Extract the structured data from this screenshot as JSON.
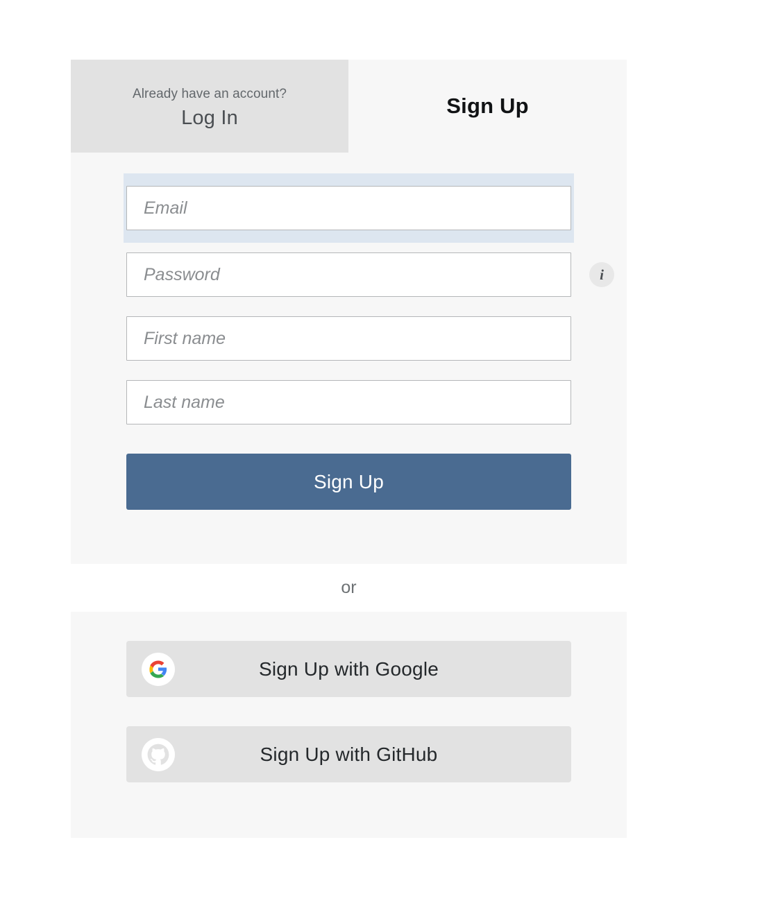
{
  "auth": {
    "tabs": {
      "login": {
        "prompt": "Already have an account?",
        "label": "Log In"
      },
      "signup": {
        "label": "Sign Up",
        "active": true
      }
    },
    "form": {
      "fields": [
        {
          "name": "email",
          "placeholder": "Email",
          "value": "",
          "type": "email",
          "focused": true
        },
        {
          "name": "password",
          "placeholder": "Password",
          "value": "",
          "type": "password",
          "focused": false,
          "info_icon": "i"
        },
        {
          "name": "first_name",
          "placeholder": "First name",
          "value": "",
          "type": "text",
          "focused": false
        },
        {
          "name": "last_name",
          "placeholder": "Last name",
          "value": "",
          "type": "text",
          "focused": false
        }
      ],
      "submit_label": "Sign Up"
    },
    "divider_label": "or",
    "social": [
      {
        "provider": "google",
        "label": "Sign Up with Google",
        "icon": "google-logo-icon"
      },
      {
        "provider": "github",
        "label": "Sign Up with GitHub",
        "icon": "github-logo-icon"
      }
    ]
  },
  "colors": {
    "primary_button": "#4a6b91",
    "active_tab_bg": "#f7f7f7",
    "inactive_tab_bg": "#e2e2e2",
    "panel_bg": "#f7f7f7",
    "social_button_bg": "#e2e2e2",
    "focus_ring": "#dde6f0",
    "google_red": "#ea4335",
    "google_yellow": "#fbbc05",
    "google_green": "#34a853",
    "google_blue": "#4285f4"
  }
}
